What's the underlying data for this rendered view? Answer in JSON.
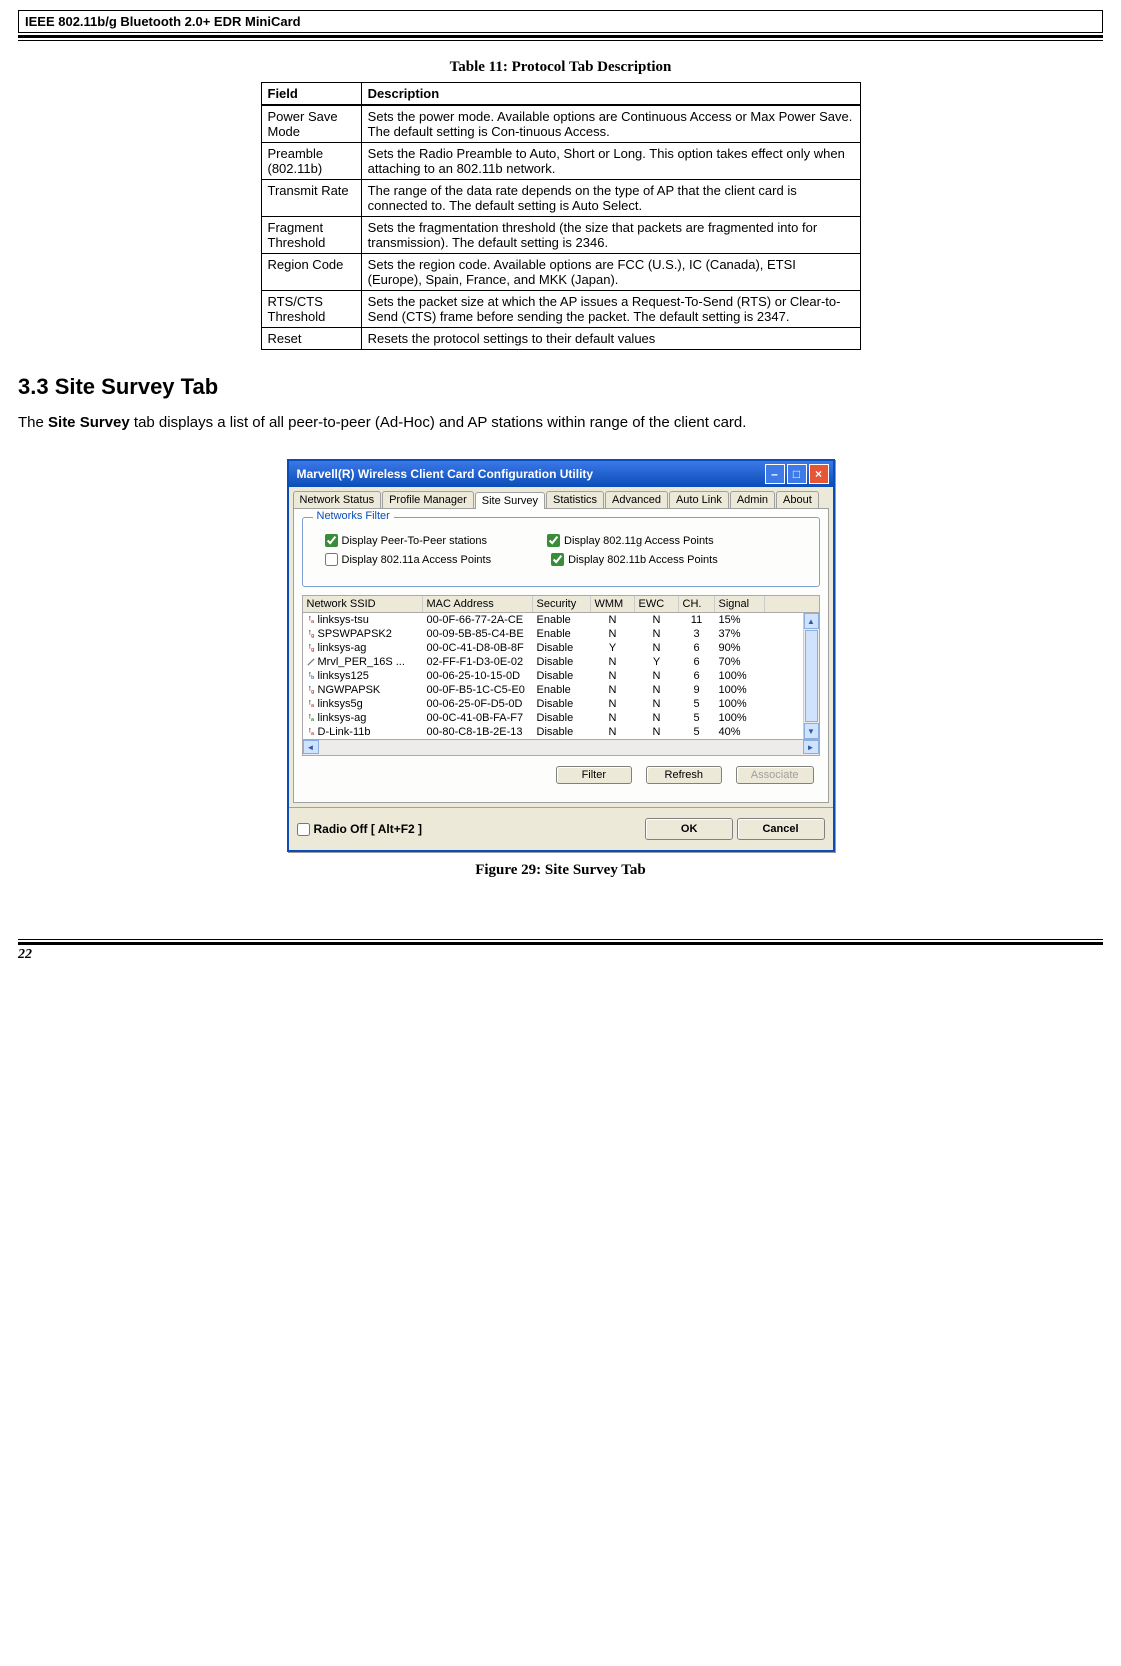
{
  "header_title": "IEEE 802.11b/g Bluetooth 2.0+ EDR MiniCard",
  "table_caption": "Table 11: Protocol Tab Description",
  "table_head": {
    "field": "Field",
    "desc": "Description"
  },
  "table_rows": [
    {
      "field": "Power Save Mode",
      "desc": "Sets the power mode. Available options are Continuous Access or Max Power Save. The default setting is Con-tinuous Access."
    },
    {
      "field": "Preamble (802.11b)",
      "desc": "Sets the Radio Preamble to Auto, Short or Long. This option takes effect only when attaching to an 802.11b network."
    },
    {
      "field": "Transmit Rate",
      "desc": "The range of the data rate depends on the type of AP that the client card is connected to. The default setting is Auto Select."
    },
    {
      "field": "Fragment Threshold",
      "desc": "Sets the fragmentation threshold (the size that packets are fragmented into for transmission). The default setting is 2346."
    },
    {
      "field": "Region Code",
      "desc": "Sets the region code. Available options are FCC (U.S.), IC (Canada), ETSI (Europe), Spain, France, and MKK (Japan)."
    },
    {
      "field": "RTS/CTS Threshold",
      "desc": "Sets the packet size at which the AP issues a Request-To-Send (RTS) or Clear-to-Send (CTS) frame before sending the packet. The default setting is 2347."
    },
    {
      "field": "Reset",
      "desc": "Resets the protocol settings to their default values"
    }
  ],
  "section_heading": "3.3 Site Survey Tab",
  "section_body_pre": "The ",
  "section_body_strong": "Site Survey",
  "section_body_post": " tab displays a list of all peer-to-peer (Ad-Hoc) and AP stations within range of the client card.",
  "dialog": {
    "title": "Marvell(R) Wireless Client Card Configuration Utility",
    "tabs": [
      "Network Status",
      "Profile Manager",
      "Site Survey",
      "Statistics",
      "Advanced",
      "Auto Link",
      "Admin",
      "About"
    ],
    "active_tab_index": 2,
    "filter": {
      "legend": "Networks Filter",
      "peer": "Display Peer-To-Peer stations",
      "g": "Display 802.11g Access Points",
      "a": "Display 802.11a Access Points",
      "b": "Display 802.11b Access Points",
      "peer_checked": true,
      "g_checked": true,
      "a_checked": false,
      "b_checked": true
    },
    "cols": {
      "ssid": "Network SSID",
      "mac": "MAC Address",
      "sec": "Security",
      "wmm": "WMM",
      "ewc": "EWC",
      "ch": "CH.",
      "sig": "Signal"
    },
    "rows": [
      {
        "icon": "a",
        "color": "#d05050",
        "ssid": "linksys-tsu",
        "mac": "00-0F-66-77-2A-CE",
        "sec": "Enable",
        "wmm": "N",
        "ewc": "N",
        "ch": "11",
        "sig": "15%"
      },
      {
        "icon": "g",
        "color": "#d05050",
        "ssid": "SPSWPAPSK2",
        "mac": "00-09-5B-85-C4-BE",
        "sec": "Enable",
        "wmm": "N",
        "ewc": "N",
        "ch": "3",
        "sig": "37%"
      },
      {
        "icon": "g",
        "color": "#d05050",
        "ssid": "linksys-ag",
        "mac": "00-0C-41-D8-0B-8F",
        "sec": "Disable",
        "wmm": "Y",
        "ewc": "N",
        "ch": "6",
        "sig": "90%"
      },
      {
        "icon": "adhoc",
        "color": "#777",
        "ssid": "Mrvl_PER_16S ...",
        "mac": "02-FF-F1-D3-0E-02",
        "sec": "Disable",
        "wmm": "N",
        "ewc": "Y",
        "ch": "6",
        "sig": "70%"
      },
      {
        "icon": "b",
        "color": "#4a74c8",
        "ssid": "linksys125",
        "mac": "00-06-25-10-15-0D",
        "sec": "Disable",
        "wmm": "N",
        "ewc": "N",
        "ch": "6",
        "sig": "100%"
      },
      {
        "icon": "g",
        "color": "#d05050",
        "ssid": "NGWPAPSK",
        "mac": "00-0F-B5-1C-C5-E0",
        "sec": "Enable",
        "wmm": "N",
        "ewc": "N",
        "ch": "9",
        "sig": "100%"
      },
      {
        "icon": "a",
        "color": "#d05050",
        "ssid": "linksys5g",
        "mac": "00-06-25-0F-D5-0D",
        "sec": "Disable",
        "wmm": "N",
        "ewc": "N",
        "ch": "5",
        "sig": "100%"
      },
      {
        "icon": "a",
        "color": "#2e9a2e",
        "ssid": "linksys-ag",
        "mac": "00-0C-41-0B-FA-F7",
        "sec": "Disable",
        "wmm": "N",
        "ewc": "N",
        "ch": "5",
        "sig": "100%"
      },
      {
        "icon": "a",
        "color": "#d05050",
        "ssid": "D-Link-11b",
        "mac": "00-80-C8-1B-2E-13",
        "sec": "Disable",
        "wmm": "N",
        "ewc": "N",
        "ch": "5",
        "sig": "40%"
      }
    ],
    "buttons": {
      "filter": "Filter",
      "refresh": "Refresh",
      "associate": "Associate"
    },
    "footer": {
      "radio_off": "Radio Off  [ Alt+F2 ]",
      "ok": "OK",
      "cancel": "Cancel"
    }
  },
  "figure_caption": "Figure 29: Site Survey Tab",
  "page_number": "22"
}
